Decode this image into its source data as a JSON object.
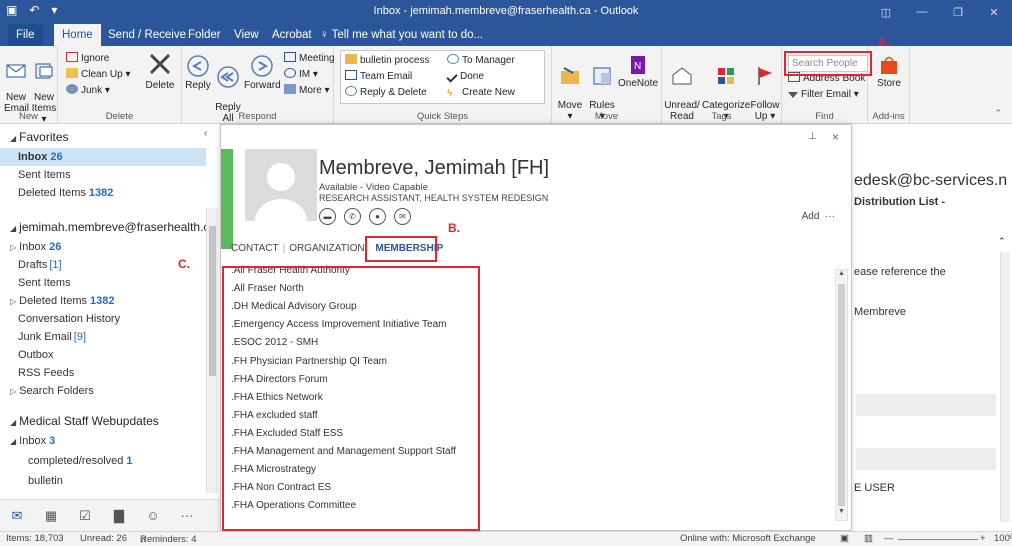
{
  "window": {
    "title": "Inbox - jemimah.membreve@fraserhealth.ca - Outlook",
    "qat": [
      "▣",
      "↶",
      "▾"
    ],
    "controls": [
      "◫",
      "—",
      "❐",
      "✕"
    ]
  },
  "menu": {
    "tabs": [
      "File",
      "Home",
      "Send / Receive",
      "Folder",
      "View",
      "Acrobat"
    ],
    "tell_me": "Tell me what you want to do..."
  },
  "ribbon": {
    "new": {
      "new_email": "New\nEmail",
      "new_items": "New\nItems ▾",
      "label": "New"
    },
    "delete": {
      "ignore": "Ignore",
      "clean_up": "Clean Up ▾",
      "junk": "Junk ▾",
      "delete": "Delete",
      "label": "Delete"
    },
    "respond": {
      "reply": "Reply",
      "reply_all": "Reply\nAll",
      "forward": "Forward",
      "meeting": "Meeting",
      "im": "IM ▾",
      "more": "More ▾",
      "label": "Respond"
    },
    "quick_steps": {
      "items": [
        "bulletin process",
        "Team Email",
        "Reply & Delete",
        "To Manager",
        "Done",
        "Create New"
      ],
      "label": "Quick Steps"
    },
    "move": {
      "move": "Move\n▾",
      "rules": "Rules\n▾",
      "onenote": "OneNote",
      "label": "Move"
    },
    "tags": {
      "unread_read": "Unread/\nRead",
      "categorize": "Categorize\n▾",
      "follow_up": "Follow\nUp ▾",
      "label": "Tags"
    },
    "find": {
      "search_people": "Search People",
      "address_book": "Address Book",
      "filter_email": "Filter Email ▾",
      "label": "Find"
    },
    "addins": {
      "store": "Store",
      "label": "Add-ins"
    }
  },
  "annotations": {
    "a": "A.",
    "b": "B.",
    "c": "C."
  },
  "nav": {
    "favorites": "Favorites",
    "fav_items": [
      {
        "label": "Inbox",
        "count": "26"
      },
      {
        "label": "Sent Items",
        "count": ""
      },
      {
        "label": "Deleted Items",
        "count": "1382"
      }
    ],
    "account": "jemimah.membreve@fraserhealth.ca",
    "account_items": [
      {
        "label": "Inbox",
        "count": "26"
      },
      {
        "label": "Drafts",
        "count": "[1]"
      },
      {
        "label": "Sent Items",
        "count": ""
      },
      {
        "label": "Deleted Items",
        "count": "1382"
      },
      {
        "label": "Conversation History",
        "count": ""
      },
      {
        "label": "Junk Email",
        "count": "[9]"
      },
      {
        "label": "Outbox",
        "count": ""
      },
      {
        "label": "RSS Feeds",
        "count": ""
      },
      {
        "label": "Search Folders",
        "count": ""
      }
    ],
    "group2": "Medical Staff Webupdates",
    "group2_inbox": {
      "label": "Inbox",
      "count": "3"
    },
    "group2_items": [
      {
        "label": "completed/resolved",
        "count": "1"
      },
      {
        "label": "bulletin",
        "count": ""
      }
    ]
  },
  "bottom_icons": [
    "mail-icon",
    "calendar-icon",
    "tasks-icon",
    "notes-icon",
    "people-icon",
    "more-icon"
  ],
  "status": {
    "items": "Items: 18,703",
    "unread": "Unread: 26",
    "reminders": "Reminders: 4",
    "online": "Online with: Microsoft Exchange",
    "zoom": "100%"
  },
  "reading": {
    "email": "edesk@bc-services.n",
    "list": "Distribution List -",
    "line1": "ease reference the",
    "line2": "Membreve",
    "line3": "E USER"
  },
  "contact": {
    "name": "Membreve, Jemimah [FH]",
    "availability": "Available - Video Capable",
    "title": "RESEARCH ASSISTANT, HEALTH SYSTEM REDESIGN",
    "add": "Add",
    "more": "···",
    "tabs": {
      "contact": "CONTACT",
      "organization": "ORGANIZATION",
      "membership": "MEMBERSHIP"
    },
    "memberships": [
      ".All Fraser Health Authority",
      ".All Fraser North",
      ".DH Medical Advisory Group",
      ".Emergency Access Improvement Initiative Team",
      ".ESOC 2012 - SMH",
      ".FH Physician Partnership QI Team",
      ".FHA Directors Forum",
      ".FHA Ethics Network",
      ".FHA excluded staff",
      ".FHA Excluded Staff ESS",
      ".FHA Management and Management Support Staff",
      ".FHA Microstrategy",
      ".FHA Non Contract ES",
      ".FHA Operations Committee"
    ]
  },
  "colors": {
    "brand": "#2b579a",
    "annotation": "#e0262e",
    "presence": "#5cb85c"
  }
}
